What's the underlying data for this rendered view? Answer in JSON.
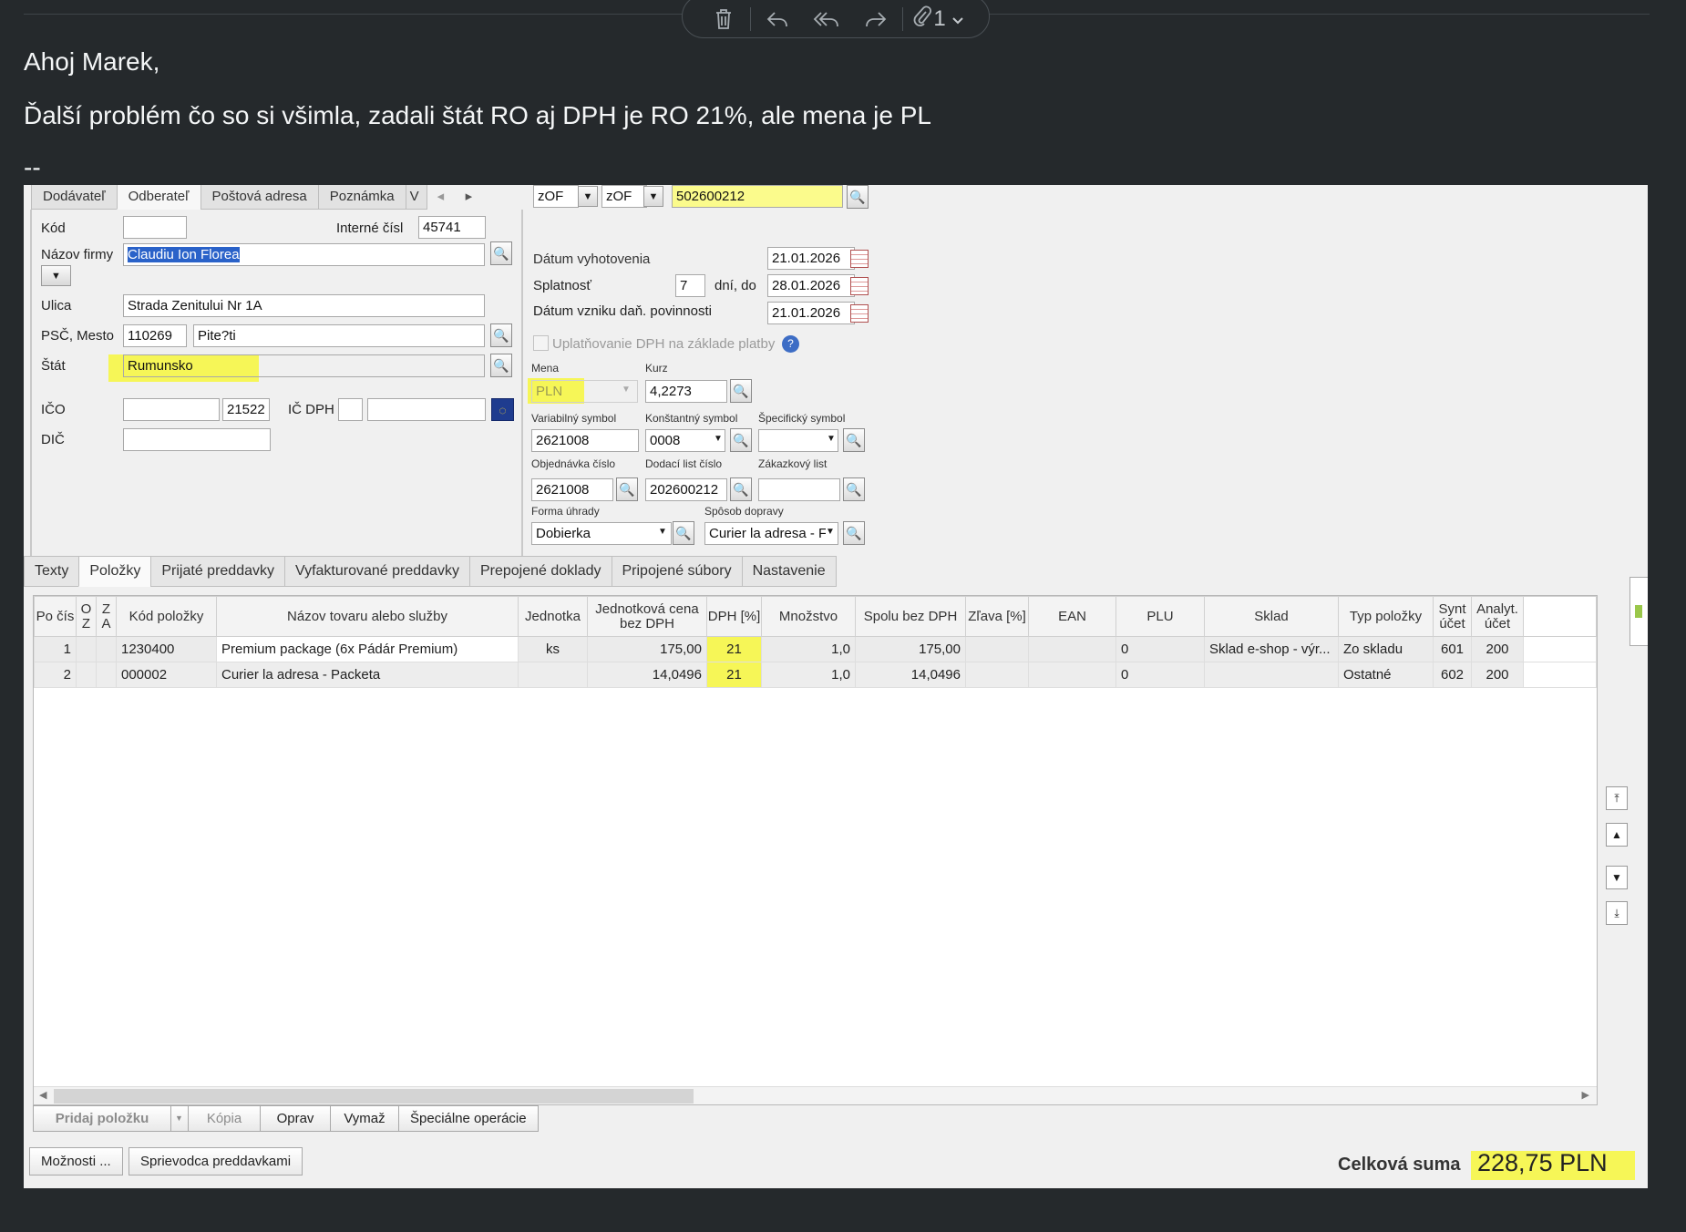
{
  "toolbar": {
    "attach_count": "1"
  },
  "email": {
    "greeting": "Ahoj Marek,",
    "body": "Ďalší problém čo so si všimla, zadali štát  RO aj DPH je RO 21%, ale mena je PL",
    "signature": "--"
  },
  "top_tabs": [
    "Dodávateľ",
    "Odberateľ",
    "Poštová adresa",
    "Poznámka",
    "V"
  ],
  "top_tabs_nav": [
    "◂",
    "▸"
  ],
  "customer": {
    "kod_label": "Kód",
    "kod": "",
    "interne_label": "Interné čísl",
    "interne": "45741",
    "nazov_label": "Názov firmy",
    "nazov": "Claudiu Ion Florea",
    "ulica_label": "Ulica",
    "ulica": "Strada Zenitului Nr 1A",
    "psc_label": "PSČ, Mesto",
    "psc": "110269",
    "mesto": "Pite?ti",
    "stat_label": "Štát",
    "stat": "Rumunsko",
    "ico_label": "IČO",
    "ico": "",
    "ico2": "21522",
    "icdph_label": "IČ DPH",
    "icdph1": "",
    "icdph2": "",
    "dic_label": "DIČ",
    "dic": ""
  },
  "doc": {
    "series1": "zOF",
    "series2": "zOF",
    "number": "502600212",
    "vyhotovenie_label": "Dátum vyhotovenia",
    "vyhotovenie": "21.01.2026",
    "splatnost_label": "Splatnosť",
    "splatnost_days": "7",
    "dni_do": "dní, do",
    "splatnost_date": "28.01.2026",
    "vznik_label": "Dátum vzniku daň. povinnosti",
    "vznik": "21.01.2026",
    "uplatnovanie": "Uplatňovanie DPH na základe platby",
    "mena_label": "Mena",
    "mena": "PLN",
    "kurz_label": "Kurz",
    "kurz": "4,2273",
    "vs_label": "Variabilný symbol",
    "vs": "2621008",
    "ks_label": "Konštantný symbol",
    "ks": "0008",
    "ss_label": "Špecifický symbol",
    "ss": "",
    "obj_label": "Objednávka číslo",
    "obj": "2621008",
    "dl_label": "Dodací list číslo",
    "dl": "202600212",
    "zak_label": "Zákazkový list",
    "zak": "",
    "forma_label": "Forma úhrady",
    "forma": "Dobierka",
    "doprava_label": "Spôsob dopravy",
    "doprava": "Curier la adresa - F"
  },
  "bottom_tabs": [
    "Texty",
    "Položky",
    "Prijaté preddavky",
    "Vyfakturované preddavky",
    "Prepojené doklady",
    "Pripojené súbory",
    "Nastavenie"
  ],
  "grid": {
    "headers": [
      "Po čís",
      "O Z",
      "Z A",
      "Kód položky",
      "Názov tovaru alebo služby",
      "Jednotka",
      "Jednotková cena bez DPH",
      "DPH [%]",
      "Množstvo",
      "Spolu bez DPH",
      "Zľava [%]",
      "EAN",
      "PLU",
      "Sklad",
      "Typ položky",
      "Synt účet",
      "Analyt. účet"
    ],
    "rows": [
      [
        "1",
        "",
        "",
        "1230400",
        "Premium package (6x Pádár Premium)",
        "ks",
        "175,00",
        "21",
        "1,0",
        "175,00",
        "",
        "",
        "0",
        "Sklad e-shop - výr...",
        "Zo skladu",
        "601",
        "200"
      ],
      [
        "2",
        "",
        "",
        "000002",
        "Curier la adresa - Packeta",
        "",
        "14,0496",
        "21",
        "1,0",
        "14,0496",
        "",
        "",
        "0",
        "",
        "Ostatné",
        "602",
        "200"
      ]
    ]
  },
  "buttons": {
    "pridaj": "Pridaj položku",
    "kopia": "Kópia",
    "oprav": "Oprav",
    "vymaz": "Vymaž",
    "specialne": "Špeciálne operácie",
    "moznosti": "Možnosti ...",
    "sprievodca": "Sprievodca preddavkami"
  },
  "total": {
    "label": "Celková suma",
    "value": "228,75  PLN"
  }
}
